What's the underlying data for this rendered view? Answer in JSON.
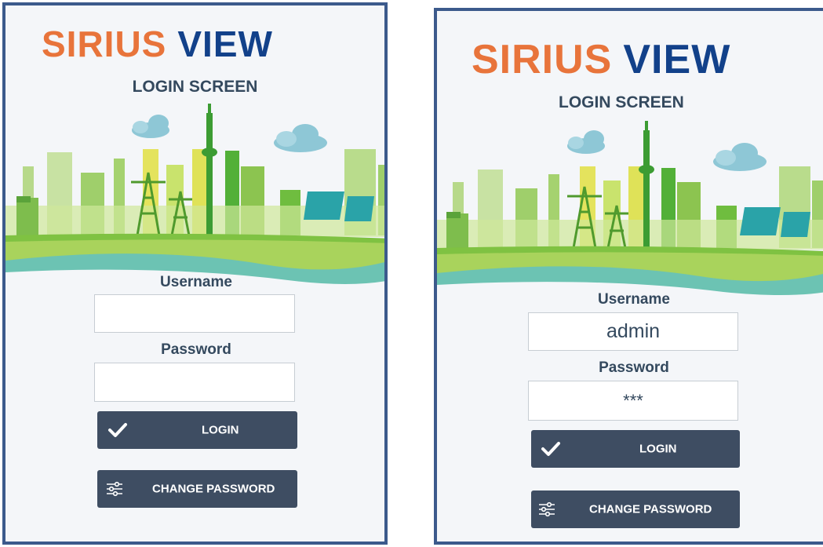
{
  "panels": [
    {
      "logo_part1": "SIRIUS",
      "logo_part2": "VIEW",
      "subtitle": "LOGIN SCREEN",
      "username_label": "Username",
      "username_value": "",
      "password_label": "Password",
      "password_value": "",
      "login_label": "LOGIN",
      "change_password_label": "CHANGE PASSWORD"
    },
    {
      "logo_part1": "SIRIUS",
      "logo_part2": "VIEW",
      "subtitle": "LOGIN SCREEN",
      "username_label": "Username",
      "username_value": "admin",
      "password_label": "Password",
      "password_value": "***",
      "login_label": "LOGIN",
      "change_password_label": "CHANGE PASSWORD"
    }
  ],
  "colors": {
    "frame": "#3c5a8c",
    "logo_orange": "#e8743b",
    "logo_blue": "#12418a",
    "button": "#3e4d62",
    "label": "#34495e"
  },
  "icons": {
    "login": "checkmark-icon",
    "change_password": "sliders-icon"
  }
}
